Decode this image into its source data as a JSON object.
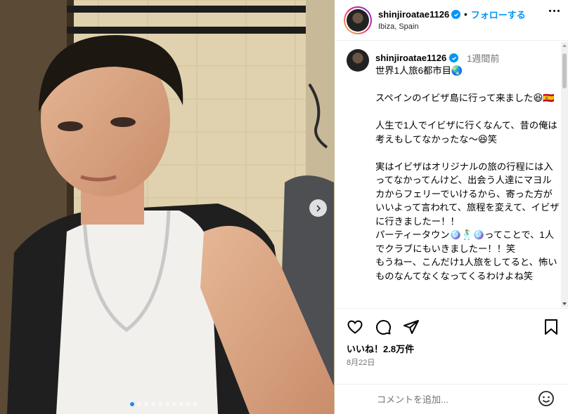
{
  "post": {
    "username": "shinjiroatae1126",
    "follow_label": "フォローする",
    "separator": "•",
    "location": "Ibiza, Spain"
  },
  "caption": {
    "username": "shinjiroatae1126",
    "time": "1週間前",
    "text": "世界1人旅6都市目🌏\n\nスペインのイビザ島に行って来ました😆🇪🇸\n\n人生で1人でイビザに行くなんて、昔の俺は考えもしてなかったな〜😆笑\n\n実はイビザはオリジナルの旅の行程には入ってなかってんけど、出会う人達にマヨルカからフェリーでいけるから、寄った方がいいよって言われて、旅程を変えて、イビザに行きましたー！！\nパーティータウン🪩🕺🪩ってことで、1人でクラブにもいきましたー！！笑\nもうねー、こんだけ1人旅をしてると、怖いものなんてなくなってくるわけよね笑"
  },
  "engagement": {
    "likes": "いいね！2.8万件",
    "date": "8月22日"
  },
  "comment": {
    "placeholder": "コメントを追加..."
  },
  "carousel": {
    "total_slides": 10,
    "current_slide": 1
  },
  "colors": {
    "accent": "#0095f6",
    "carousel_active_dot": "#1d8cf0"
  }
}
